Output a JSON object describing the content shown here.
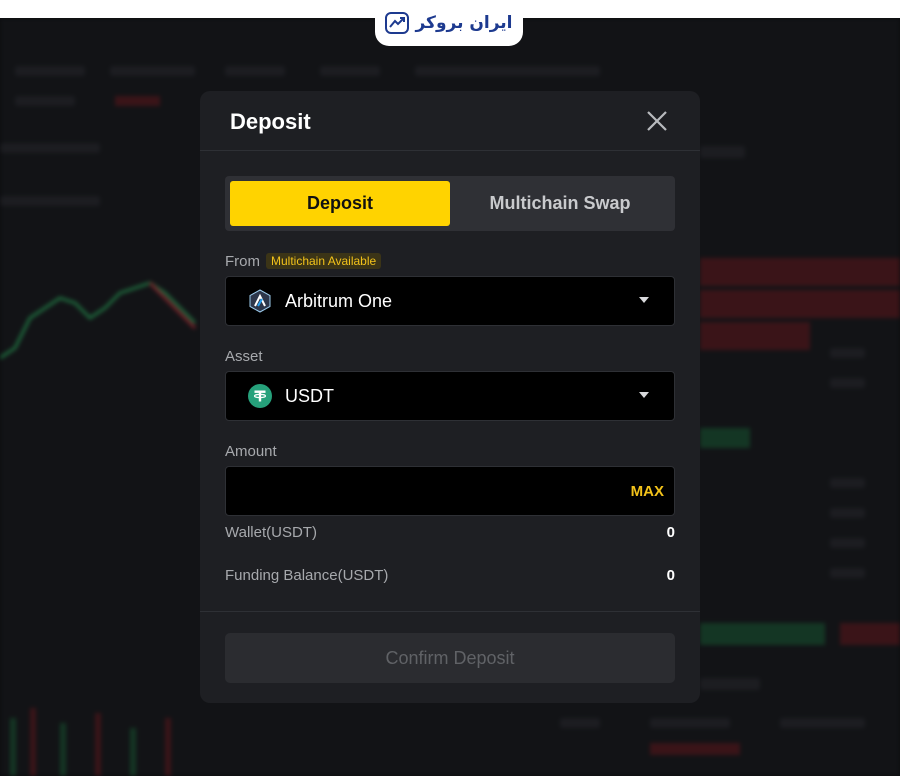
{
  "logo": {
    "text": "ایران بروکر",
    "icon": "chart-trend-icon"
  },
  "modal": {
    "title": "Deposit",
    "close_icon": "close-icon",
    "tabs": [
      {
        "label": "Deposit",
        "active": true
      },
      {
        "label": "Multichain Swap",
        "active": false
      }
    ],
    "from": {
      "label": "From",
      "badge": "Multichain Available",
      "selected": "Arbitrum One",
      "icon": "arbitrum-icon"
    },
    "asset": {
      "label": "Asset",
      "selected": "USDT",
      "icon": "tether-icon"
    },
    "amount": {
      "label": "Amount",
      "value": "",
      "max_label": "MAX"
    },
    "wallet": {
      "label": "Wallet(USDT)",
      "value": "0"
    },
    "funding": {
      "label": "Funding Balance(USDT)",
      "value": "0"
    },
    "confirm_label": "Confirm Deposit"
  },
  "colors": {
    "accent": "#ffd300",
    "badge_text": "#f2c21a",
    "modal_bg": "#1e1f23",
    "tether": "#26a17b"
  }
}
